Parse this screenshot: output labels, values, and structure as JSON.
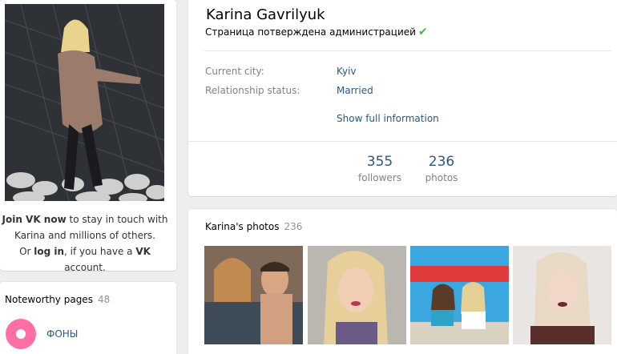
{
  "left": {
    "join": {
      "join_link": "Join VK now",
      "line1_rest": " to stay in touch with",
      "line2": "Karina and millions of others.",
      "or": "Or ",
      "login_link": "log in",
      "if_you_have": ", if you have a ",
      "vk": "VK",
      "account": " account."
    },
    "noteworthy": {
      "title": "Noteworthy pages",
      "count": "48",
      "items": [
        {
          "label": "ФОНЫ"
        }
      ]
    }
  },
  "profile": {
    "name": "Karina Gavrilyuk",
    "verified_text": "Страница потверждена администрацией",
    "verified_icon": "✔",
    "fields": [
      {
        "label": "Current city:",
        "value": "Kyiv"
      },
      {
        "label": "Relationship status:",
        "value": "Married"
      }
    ],
    "show_full": "Show full information",
    "counters": [
      {
        "num": "355",
        "label": "followers"
      },
      {
        "num": "236",
        "label": "photos"
      }
    ]
  },
  "photos": {
    "title": "Karina's photos",
    "count": "236"
  },
  "colors": {
    "link": "#2a5885",
    "muted": "#828282",
    "bg": "#edeef0",
    "verified": "#4bb34b"
  }
}
